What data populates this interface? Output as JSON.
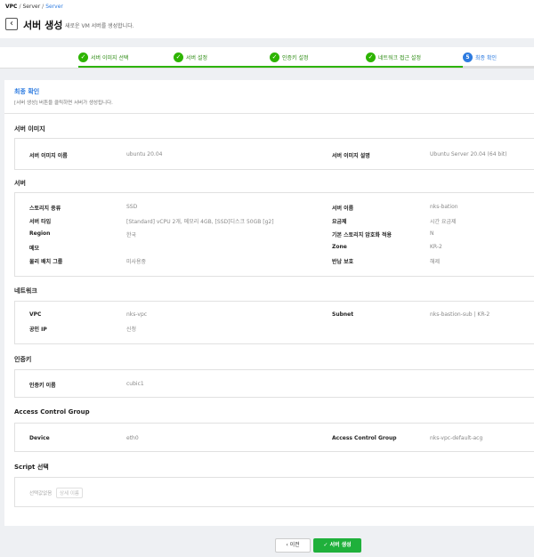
{
  "breadcrumb": {
    "vpc": "VPC",
    "server": "Server",
    "current": "Server",
    "sep": "/"
  },
  "header": {
    "title": "서버 생성",
    "subtitle": "새로운 VM 서버를 생성합니다."
  },
  "steps": [
    {
      "label": "서버 이미지 선택",
      "mark": "✓"
    },
    {
      "label": "서버 설정",
      "mark": "✓"
    },
    {
      "label": "인증키 설정",
      "mark": "✓"
    },
    {
      "label": "네트워크 접근 설정",
      "mark": "✓"
    },
    {
      "label": "최종 확인",
      "mark": "5"
    }
  ],
  "confirm": {
    "title": "최종 확인",
    "desc": "[서버 생성] 버튼을 클릭하면 서버가 생성됩니다."
  },
  "image_section": {
    "title": "서버 이미지",
    "name_label": "서버 이미지 이름",
    "name_value": "ubuntu 20.04",
    "desc_label": "서버 이미지 설명",
    "desc_value": "Ubuntu Server 20.04 (64 bit)"
  },
  "server_section": {
    "title": "서버",
    "rows": [
      {
        "l1": "스토리지 종류",
        "v1": "SSD",
        "l2": "서버 이름",
        "v2": "nks-bation"
      },
      {
        "l1": "서버 타입",
        "v1": "[Standard] vCPU 2개, 메모리 4GB, [SSD]디스크 50GB [g2]",
        "l2": "요금제",
        "v2": "시간 요금제"
      },
      {
        "l1": "Region",
        "v1": "한국",
        "l2": "기본 스토리지 암호화 적용",
        "v2": "N"
      },
      {
        "l1": "메모",
        "v1": "",
        "l2": "Zone",
        "v2": "KR-2"
      },
      {
        "l1": "물리 배치 그룹",
        "v1": "미사용중",
        "l2": "반납 보호",
        "v2": "해제"
      }
    ]
  },
  "network_section": {
    "title": "네트워크",
    "vpc_label": "VPC",
    "vpc_value": "nks-vpc",
    "subnet_label": "Subnet",
    "subnet_value": "nks-bastion-sub | KR-2",
    "ip_label": "공인 IP",
    "ip_value": "신청"
  },
  "auth_section": {
    "title": "인증키",
    "key_label": "인증키 이름",
    "key_value": "cubic1"
  },
  "acg_section": {
    "title": "Access Control Group",
    "device_label": "Device",
    "device_value": "eth0",
    "acg_label": "Access Control Group",
    "acg_value": "nks-vpc-default-acg"
  },
  "script_section": {
    "title": "Script 선택",
    "selected_label": "선택값없음",
    "detail_button": "상세 이름"
  },
  "buttons": {
    "prev": "이전",
    "create": "서버 생성"
  },
  "colors": {
    "accent": "#2d7be0",
    "success": "#2db400",
    "primary_button": "#1fb03b"
  }
}
